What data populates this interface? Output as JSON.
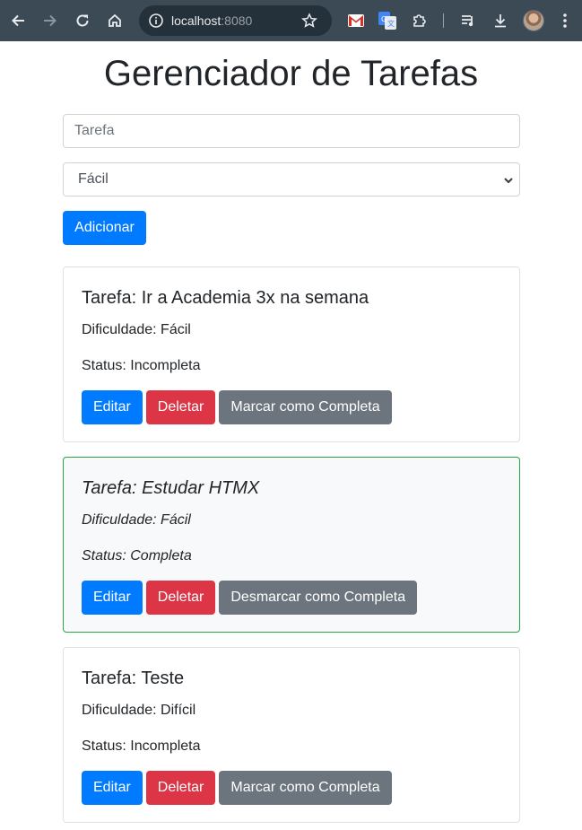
{
  "browser": {
    "url_host": "localhost",
    "url_port": ":8080"
  },
  "page": {
    "title": "Gerenciador de Tarefas"
  },
  "form": {
    "task_placeholder": "Tarefa",
    "task_value": "",
    "difficulty_selected": "Fácil",
    "add_label": "Adicionar"
  },
  "tasks": [
    {
      "title": "Tarefa: Ir a Academia 3x na semana",
      "difficulty": "Dificuldade: Fácil",
      "status": "Status: Incompleta",
      "edit_label": "Editar",
      "delete_label": "Deletar",
      "toggle_label": "Marcar como Completa",
      "completed": false
    },
    {
      "title": "Tarefa: Estudar HTMX",
      "difficulty": "Dificuldade: Fácil",
      "status": "Status: Completa",
      "edit_label": "Editar",
      "delete_label": "Deletar",
      "toggle_label": "Desmarcar como Completa",
      "completed": true
    },
    {
      "title": "Tarefa: Teste",
      "difficulty": "Dificuldade: Difícil",
      "status": "Status: Incompleta",
      "edit_label": "Editar",
      "delete_label": "Deletar",
      "toggle_label": "Marcar como Completa",
      "completed": false
    }
  ],
  "colors": {
    "primary": "#007bff",
    "danger": "#dc3545",
    "secondary": "#6c757d",
    "success_border": "#28a745",
    "chrome_bg": "#3c4a56"
  }
}
